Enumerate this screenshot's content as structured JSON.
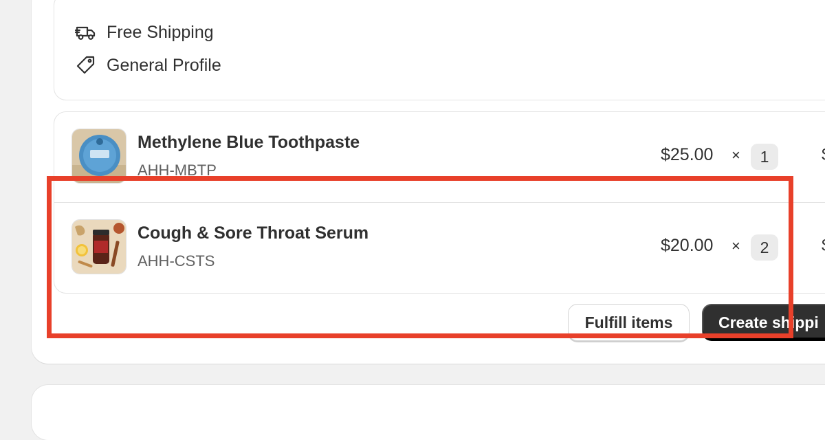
{
  "shipping": {
    "method_label": "Free Shipping",
    "profile_label": "General Profile",
    "method_icon": "truck-icon",
    "profile_icon": "tag-icon"
  },
  "items": [
    {
      "name": "Methylene Blue Toothpaste",
      "sku": "AHH-MBTP",
      "price": "$25.00",
      "times": "×",
      "quantity": "1",
      "total_fragment": "$"
    },
    {
      "name": "Cough & Sore Throat Serum",
      "sku": "AHH-CSTS",
      "price": "$20.00",
      "times": "×",
      "quantity": "2",
      "total_fragment": "$"
    }
  ],
  "actions": {
    "fulfill_label": "Fulfill items",
    "create_label": "Create shippi"
  },
  "colors": {
    "highlight": "#e8402a",
    "primary_button": "#303030",
    "page_background": "#f1f1f1"
  }
}
